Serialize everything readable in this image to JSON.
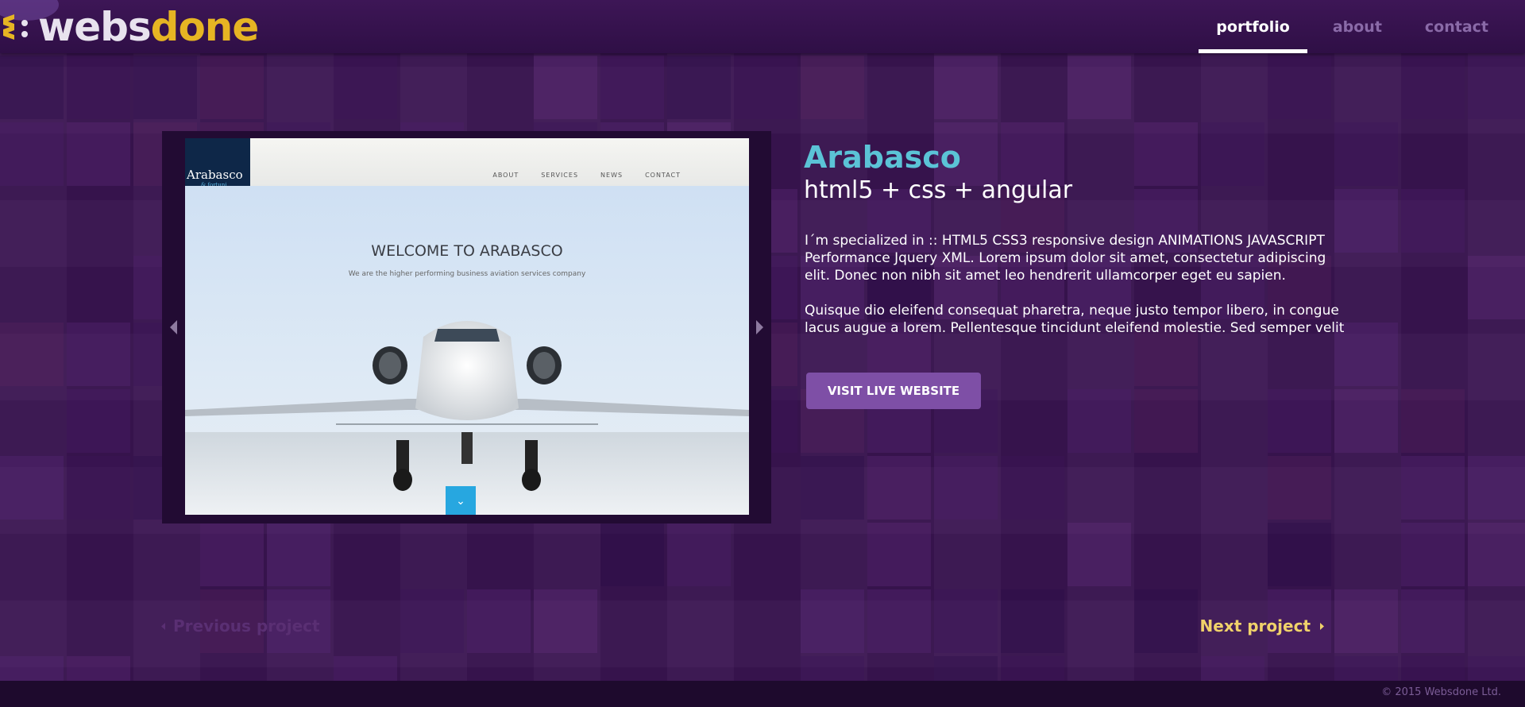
{
  "brand": {
    "logo_part1": "webs",
    "logo_part2": "done",
    "accent_gold": "#e6b523"
  },
  "nav": {
    "items": [
      {
        "label": "portfolio",
        "active": true
      },
      {
        "label": "about",
        "active": false
      },
      {
        "label": "contact",
        "active": false
      }
    ]
  },
  "slider": {
    "prev_icon": "chevron-left-icon",
    "next_icon": "chevron-right-icon",
    "screenshot": {
      "logo_text": "Arabasco",
      "logo_sub": "& fortuni",
      "menu": [
        "ABOUT",
        "SERVICES",
        "NEWS",
        "CONTACT"
      ],
      "headline": "WELCOME TO ARABASCO",
      "subline": "We are the higher performing business aviation services company"
    }
  },
  "project": {
    "title": "Arabasco",
    "tech": "html5 + css + angular",
    "description_1": "I´m specialized in :: HTML5 CSS3 responsive design ANIMATIONS JAVASCRIPT Performance Jquery XML. Lorem ipsum dolor sit amet, consectetur adipiscing elit. Donec non nibh sit amet leo hendrerit ullamcorper eget eu sapien.",
    "description_2": "Quisque dio eleifend consequat pharetra, neque justo tempor libero, in congue lacus augue a lorem. Pellentesque tincidunt eleifend molestie. Sed semper velit",
    "visit_label": "VISIT LIVE WEBSITE",
    "title_color": "#5bc3d6",
    "button_color": "#7e4fa6"
  },
  "pagination": {
    "prev_label": "Previous project",
    "next_label": "Next project",
    "next_color": "#f0d26a"
  },
  "footer": {
    "copyright": "© 2015 Websdone Ltd."
  }
}
